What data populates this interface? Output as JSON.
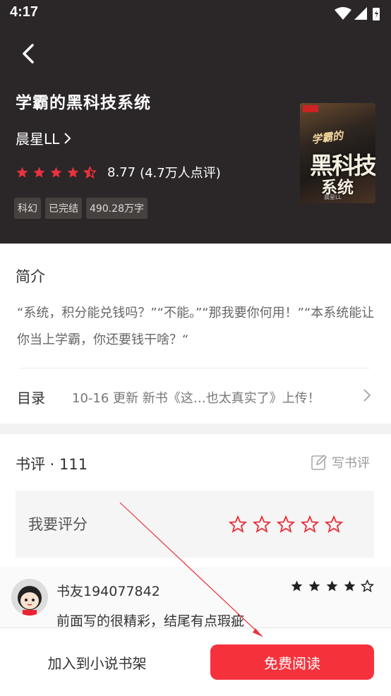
{
  "status": {
    "time": "4:17"
  },
  "book": {
    "title": "学霸的黑科技系统",
    "author": "晨星LL",
    "rating": "8.77",
    "rating_count": "(4.7万人点评)",
    "tags": [
      "科幻",
      "已完结",
      "490.28万字"
    ],
    "cover_title_small": "学霸的",
    "cover_title_large": "黑科技",
    "cover_title_bottom": "系统",
    "cover_author": "晨星LL"
  },
  "intro": {
    "title": "简介",
    "text": "“系统，积分能兑钱吗？”“不能。”“那我要你何用！”“本系统能让你当上学霸，你还要钱干啥？“"
  },
  "toc": {
    "label": "目录",
    "latest": "10-16  更新  新书《这…也太真实了》上传！"
  },
  "reviews": {
    "title": "书评 · 111",
    "write_label": "写书评",
    "rate_label": "我要评分",
    "comment": {
      "user": "书友194077842",
      "text": "前面写的很精彩，结尾有点瑕疵",
      "stars": 4
    }
  },
  "bottom": {
    "add_shelf": "加入到小说书架",
    "read": "免费阅读"
  },
  "colors": {
    "accent": "#f5323c",
    "header_bg": "#2b2628",
    "star": "#e8323c"
  },
  "icons": [
    "back-arrow-icon",
    "wifi-icon",
    "signal-icon",
    "battery-icon",
    "chevron-right-icon",
    "star-icon",
    "edit-icon"
  ]
}
